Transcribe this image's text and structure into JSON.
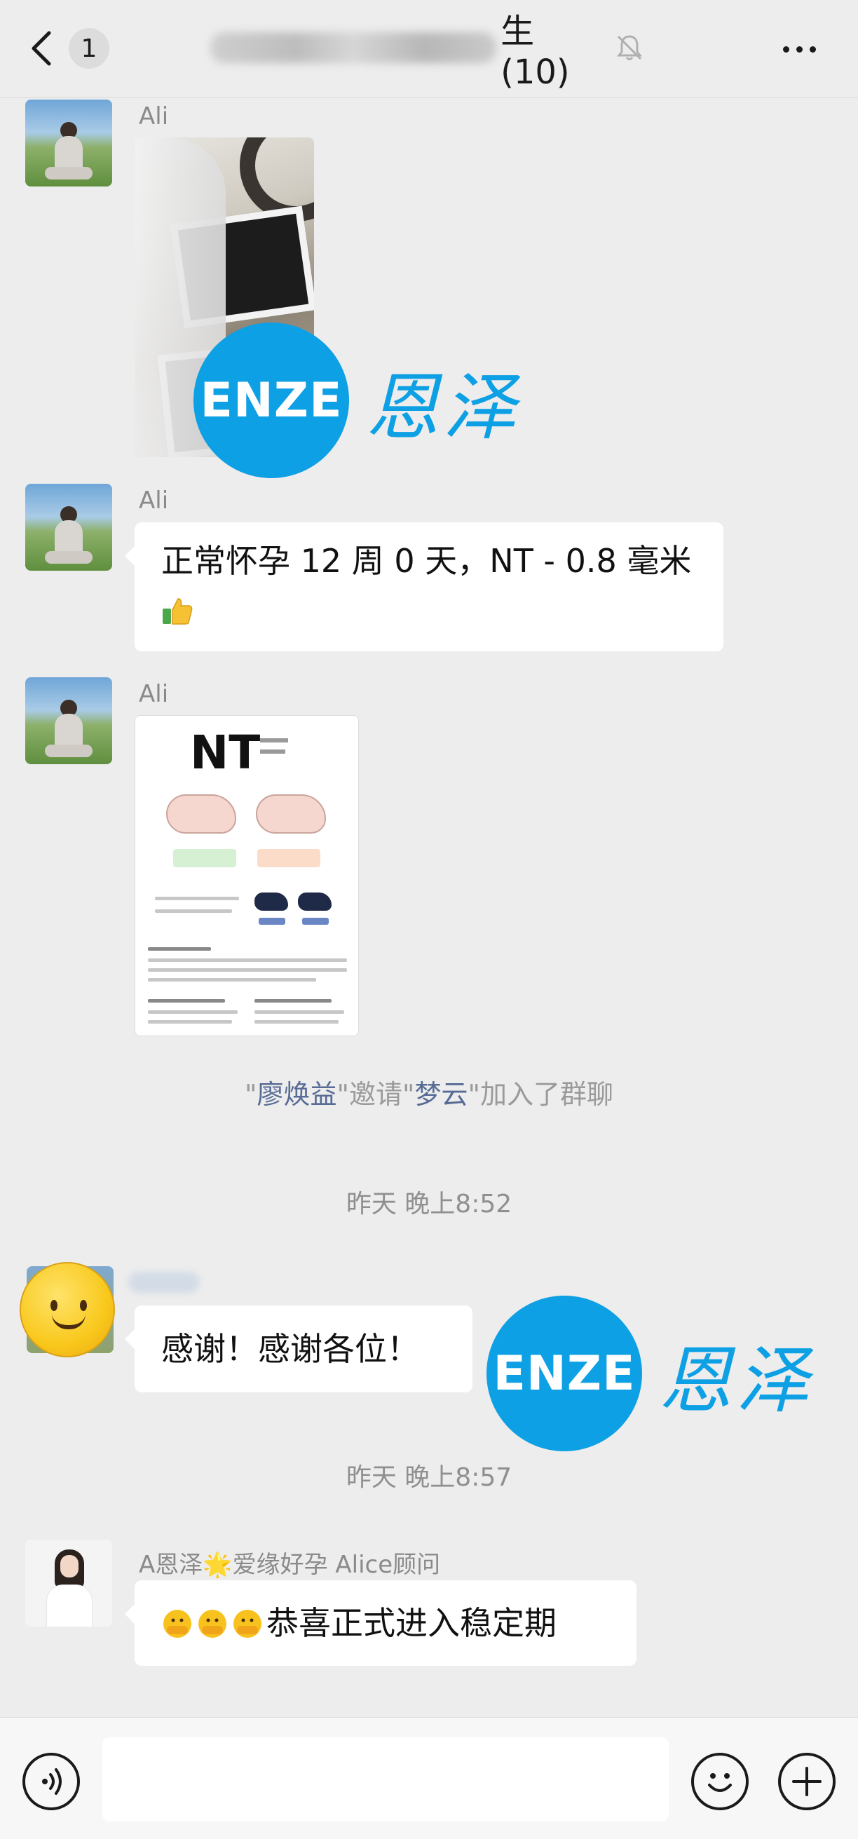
{
  "header": {
    "back_badge": "1",
    "title_visible_suffix": "生(10)",
    "mute": "muted-bell"
  },
  "messages": [
    {
      "sender": "Ali",
      "type": "image",
      "image_desc": "ultrasound-photo"
    },
    {
      "sender": "Ali",
      "type": "text",
      "text": "正常怀孕 12 周 0 天，NT - 0.8 毫米",
      "emoji": "thumbs-up"
    },
    {
      "sender": "Ali",
      "type": "image",
      "image_desc": "nt-infographic",
      "image_title": "NT"
    }
  ],
  "system": {
    "invite": {
      "inviter": "廖焕益",
      "invitee": "梦云",
      "q1": "\"",
      "q2": "\"邀请\"",
      "q3": "\"加入了群聊"
    }
  },
  "timestamps": {
    "t1": "昨天 晚上8:52",
    "t2": "昨天 晚上8:57"
  },
  "message_thanks": {
    "text": "感谢！感谢各位！"
  },
  "message_alice": {
    "sender": "A恩泽🌟爱缘好孕 Alice顾问",
    "text": "恭喜正式进入稳定期",
    "emoji": "hiding-face x3"
  },
  "watermark": {
    "logo_text": "ENZE",
    "logo_cn": "恩泽"
  },
  "input": {
    "placeholder": ""
  },
  "colors": {
    "bg": "#ededed",
    "bubble": "#ffffff",
    "brand": "#0ea0e4",
    "link_name": "#576b95"
  }
}
